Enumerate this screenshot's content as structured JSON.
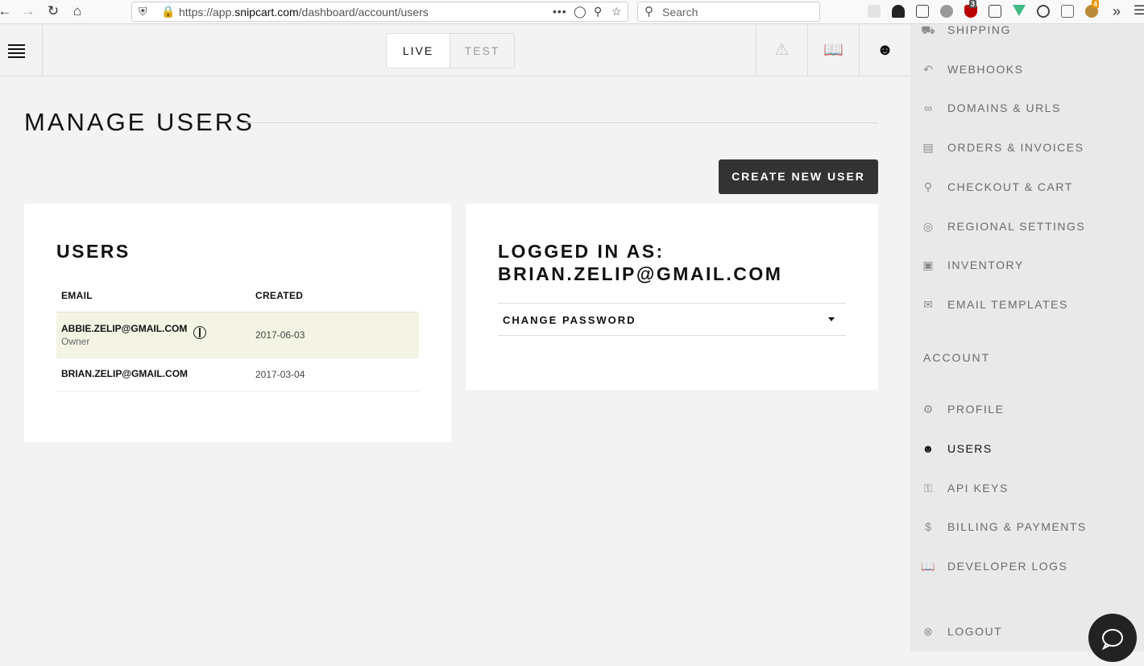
{
  "browser": {
    "url_prefix": "https://app.",
    "url_domain": "snipcart.com",
    "url_path": "/dashboard/account/users",
    "search_placeholder": "Search",
    "ext_badge_1": "3",
    "ext_badge_2": "4"
  },
  "header": {
    "modes": [
      {
        "label": "LIVE",
        "active": true
      },
      {
        "label": "TEST",
        "active": false
      }
    ]
  },
  "main": {
    "title": "MANAGE USERS",
    "create_button": "CREATE NEW USER",
    "users_card": {
      "title": "USERS",
      "columns": [
        "EMAIL",
        "CREATED"
      ],
      "rows": [
        {
          "email": "ABBIE.ZELIP@GMAIL.COM",
          "role": "Owner",
          "created": "2017-06-03"
        },
        {
          "email": "BRIAN.ZELIP@GMAIL.COM",
          "role": "",
          "created": "2017-03-04"
        }
      ]
    },
    "login_card": {
      "title_line1": "LOGGED IN AS:",
      "title_line2": "BRIAN.ZELIP@GMAIL.COM",
      "change_password": "CHANGE PASSWORD"
    }
  },
  "sidebar": {
    "items": [
      {
        "label": "SHIPPING",
        "icon": "truck-icon"
      },
      {
        "label": "WEBHOOKS",
        "icon": "webhook-icon"
      },
      {
        "label": "DOMAINS & URLS",
        "icon": "link-icon"
      },
      {
        "label": "ORDERS & INVOICES",
        "icon": "invoice-icon"
      },
      {
        "label": "CHECKOUT & CART",
        "icon": "cart-icon"
      },
      {
        "label": "REGIONAL SETTINGS",
        "icon": "globe-icon"
      },
      {
        "label": "INVENTORY",
        "icon": "box-icon"
      },
      {
        "label": "EMAIL TEMPLATES",
        "icon": "envelope-icon"
      }
    ],
    "account_section": "ACCOUNT",
    "account_items": [
      {
        "label": "PROFILE",
        "icon": "gear-icon",
        "active": false
      },
      {
        "label": "USERS",
        "icon": "users-icon",
        "active": true
      },
      {
        "label": "API KEYS",
        "icon": "key-icon",
        "active": false
      },
      {
        "label": "BILLING & PAYMENTS",
        "icon": "dollar-icon",
        "active": false
      },
      {
        "label": "DEVELOPER LOGS",
        "icon": "book-icon",
        "active": false
      }
    ],
    "logout": "LOGOUT"
  },
  "colors": {
    "accent_dark": "#333333",
    "selected_row": "#f4f4e4",
    "sidebar_bg": "#e9e9e9",
    "page_bg": "#f3f3f3"
  }
}
